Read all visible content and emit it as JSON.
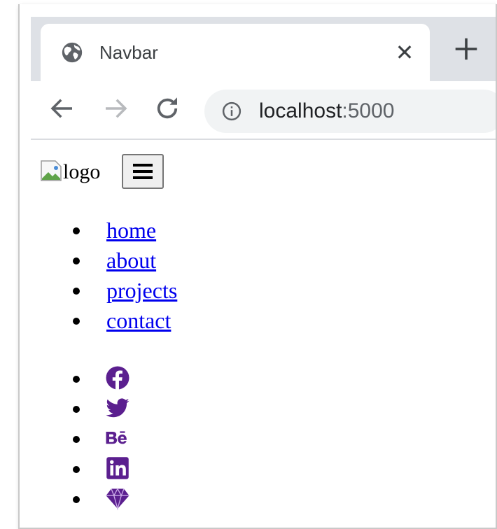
{
  "browser": {
    "tab": {
      "title": "Navbar",
      "icon": "globe-icon",
      "close_glyph": "✕"
    },
    "url": {
      "host": "localhost",
      "port": ":5000"
    }
  },
  "page": {
    "logo_alt": "logo",
    "nav_links": [
      {
        "label": "home"
      },
      {
        "label": "about"
      },
      {
        "label": "projects"
      },
      {
        "label": "contact"
      }
    ],
    "social_icons": [
      {
        "name": "facebook-icon"
      },
      {
        "name": "twitter-icon"
      },
      {
        "name": "behance-icon"
      },
      {
        "name": "linkedin-icon"
      },
      {
        "name": "sketch-icon"
      }
    ]
  },
  "colors": {
    "link": "#0000ee",
    "social_icon": "#5b1f8f",
    "tab_strip": "#dee1e6",
    "omnibox": "#f1f3f4"
  }
}
